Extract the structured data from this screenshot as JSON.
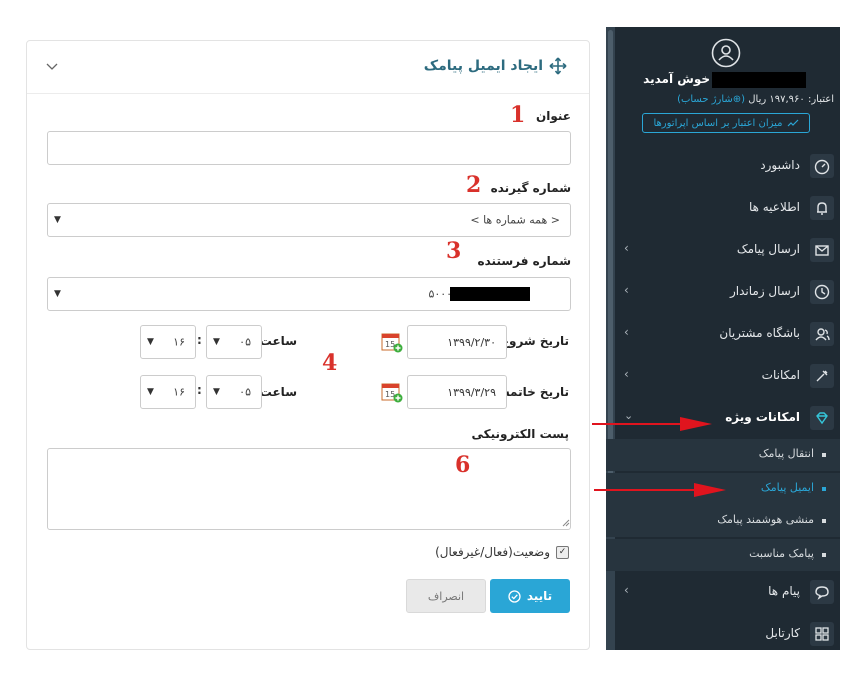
{
  "form": {
    "title": "ایجاد ایمیل پیامک",
    "subject_label": "عنوان",
    "subject_value": "",
    "receiver_label": "شماره گیرنده",
    "receiver_value": "< همه شماره ها >",
    "sender_label": "شماره فرستنده",
    "sender_value": "۵۰۰۰۱",
    "start_date_label": "تاریخ شروع",
    "start_date_value": "۱۳۹۹/۲/۳۰",
    "end_date_label": "تاریخ خاتمه",
    "end_date_value": "۱۳۹۹/۳/۲۹",
    "time_label": "ساعت",
    "time_colon": ":",
    "start_hour": "۱۶",
    "start_minute": "۰۵",
    "end_hour": "۱۶",
    "end_minute": "۰۵",
    "email_label": "پست الکترونیکی",
    "email_value": "",
    "status_label": "وضعیت(فعال/غیرفعال)",
    "status_checked": true,
    "confirm_label": "تایید",
    "cancel_label": "انصراف"
  },
  "annotations": [
    "1",
    "2",
    "3",
    "4",
    "6"
  ],
  "sidebar": {
    "welcome": "خوش آمدید",
    "credit_text": "اعتبار: ۱۹۷,۹۶۰ ریال",
    "charge_link": "(⊕شارژ حساب)",
    "operator_credit": "میزان اعتبار بر اساس اپراتورها",
    "items": [
      {
        "label": "داشبورد",
        "icon": "dashboard-icon",
        "has_children": false
      },
      {
        "label": "اطلاعیه ها",
        "icon": "bell-icon",
        "has_children": false
      },
      {
        "label": "ارسال پیامک",
        "icon": "envelope-icon",
        "has_children": true
      },
      {
        "label": "ارسال زماندار",
        "icon": "clock-icon",
        "has_children": true
      },
      {
        "label": "باشگاه مشتریان",
        "icon": "users-icon",
        "has_children": true
      },
      {
        "label": "امکانات",
        "icon": "tools-icon",
        "has_children": true
      },
      {
        "label": "امکانات ویژه",
        "icon": "diamond-icon",
        "has_children": true
      },
      {
        "label": "پیام ها",
        "icon": "chat-icon",
        "has_children": true
      },
      {
        "label": "کارتابل",
        "icon": "grid-icon",
        "has_children": false
      }
    ],
    "sub_items": [
      "انتقال پیامک",
      "ایمیل پیامک",
      "منشی هوشمند پیامک",
      "پیامک مناسبت"
    ],
    "active_sub": 1
  },
  "colors": {
    "sidebar_bg": "#1f2a33",
    "accent": "#2aa6d6",
    "title": "#2d6b7f",
    "annotation": "#d9312b"
  }
}
